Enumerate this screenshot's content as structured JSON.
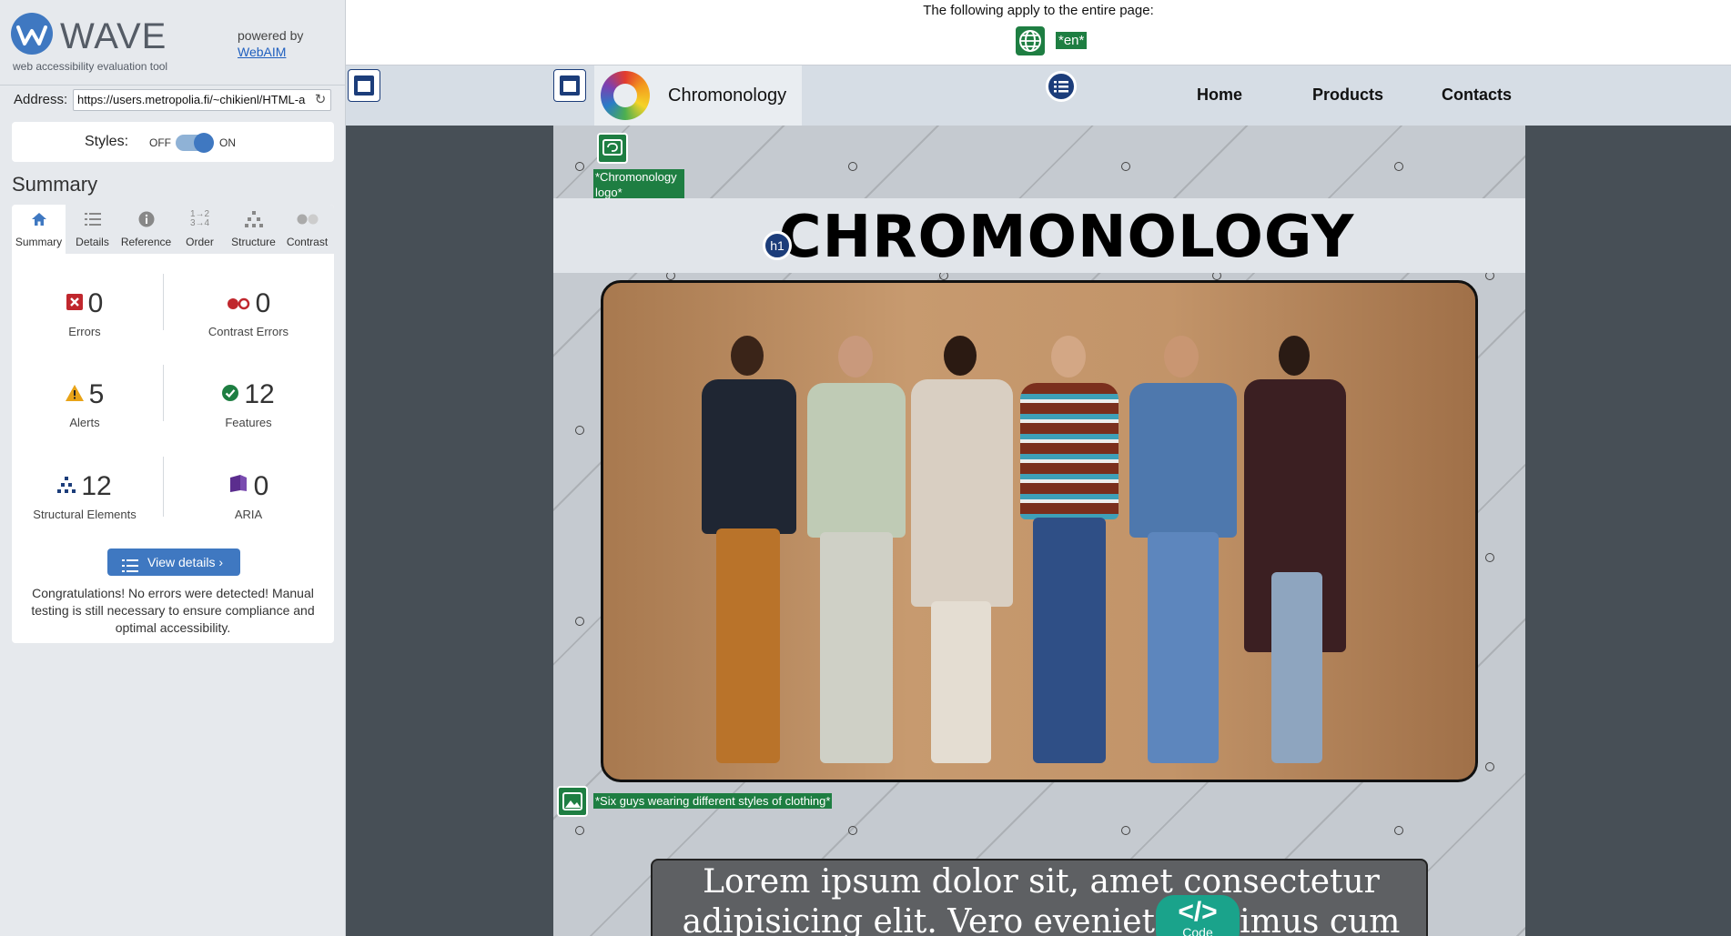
{
  "wave": {
    "logo_text": "WAVE",
    "tagline": "web accessibility evaluation tool",
    "powered_by": "powered by",
    "webaim_link": "WebAIM",
    "address_label": "Address:",
    "address_value": "https://users.metropolia.fi/~chikienl/HTML-a",
    "styles_label": "Styles:",
    "styles_off": "OFF",
    "styles_on": "ON",
    "summary_title": "Summary",
    "tabs": [
      {
        "label": "Summary",
        "icon": "home-icon"
      },
      {
        "label": "Details",
        "icon": "list-icon"
      },
      {
        "label": "Reference",
        "icon": "info-icon"
      },
      {
        "label": "Order",
        "icon": "order-icon"
      },
      {
        "label": "Structure",
        "icon": "structure-icon"
      },
      {
        "label": "Contrast",
        "icon": "contrast-icon"
      }
    ],
    "stats": {
      "errors": {
        "value": "0",
        "label": "Errors"
      },
      "contrast_errors": {
        "value": "0",
        "label": "Contrast Errors"
      },
      "alerts": {
        "value": "5",
        "label": "Alerts"
      },
      "features": {
        "value": "12",
        "label": "Features"
      },
      "structural": {
        "value": "12",
        "label": "Structural Elements"
      },
      "aria": {
        "value": "0",
        "label": "ARIA"
      }
    },
    "view_details": "View details ›",
    "congrats": "Congratulations! No errors were detected! Manual testing is still necessary to ensure compliance and optimal accessibility."
  },
  "page_banner": {
    "text": "The following apply to the entire page:",
    "lang": "*en*"
  },
  "site": {
    "brand": "Chromonology",
    "nav": [
      "Home",
      "Products",
      "Contacts"
    ],
    "logo_alt": "*Chromonology logo*",
    "title": "CHROMONOLOGY",
    "h1_tag": "h1",
    "hero_alt": "*Six guys wearing different styles of clothing*",
    "lorem": "Lorem ipsum dolor sit, amet consectetur adipisicing elit. Vero eveniet possimus cum",
    "code_label": "Code",
    "code_glyph": "</>"
  },
  "colors": {
    "wave_blue": "#3f78c1",
    "feature_green": "#1e7e42",
    "structure_navy": "#1c3d7a",
    "error_red": "#c0272d",
    "alert_orange": "#e8a317",
    "aria_purple": "#5b2d8e",
    "code_teal": "#1aa38b"
  }
}
